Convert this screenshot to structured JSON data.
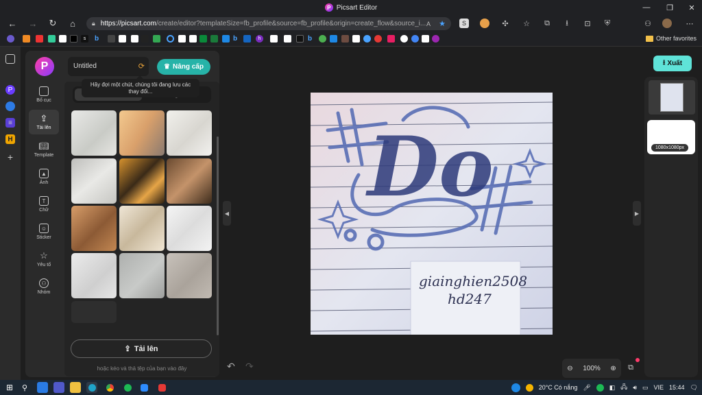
{
  "browser": {
    "window_title": "Picsart Editor",
    "url_host": "https://picsart.com",
    "url_rest": "/create/editor?templateSize=fb_profile&source=fb_profile&origin=create_flow&source_i...",
    "other_favorites": "Other favorites",
    "bookmark_s": "s",
    "bookmark_h": "h"
  },
  "app": {
    "logo": "P",
    "document_title": "Untitled",
    "upgrade_label": "Nâng cấp",
    "tooltip": "Hãy đợi một chút, chúng tôi đang lưu các thay đổi...",
    "export_label": "Xuất",
    "tools": [
      {
        "label": "Bố cục",
        "icon": "layout-icon"
      },
      {
        "label": "Tải lên",
        "icon": "upload-icon"
      },
      {
        "label": "Template",
        "icon": "template-icon"
      },
      {
        "label": "Ảnh",
        "icon": "image-icon"
      },
      {
        "label": "Chữ",
        "icon": "text-icon"
      },
      {
        "label": "Sticker",
        "icon": "sticker-icon"
      },
      {
        "label": "Yêu tố",
        "icon": "star-icon"
      },
      {
        "label": "Nhóm",
        "icon": "group-icon"
      }
    ],
    "tabs": [
      "Hình ảnh",
      "Phông chữ"
    ],
    "upload_button": "Tải lên",
    "drop_hint": "hoặc kéo và thả tệp của bạn vào đây",
    "zoom": "100%",
    "page_size_label": "1080x1080px",
    "canvas_text_line1": "giainghien2508",
    "canvas_text_line2": "hd247",
    "canvas_art_text": "Do"
  },
  "taskbar": {
    "weather": "20°C Có nắng",
    "language": "VIE",
    "time": "15:44"
  }
}
